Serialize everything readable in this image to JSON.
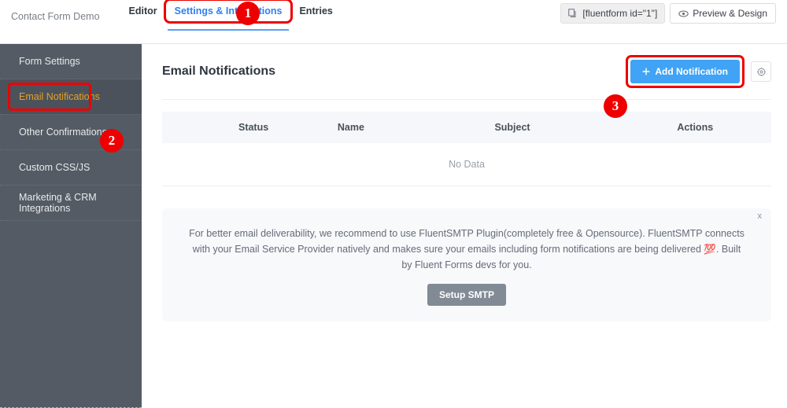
{
  "topbar": {
    "form_title": "Contact Form Demo",
    "tabs": [
      {
        "label": "Editor",
        "active": false
      },
      {
        "label": "Settings & Integrations",
        "active": true
      },
      {
        "label": "Entries",
        "active": false
      }
    ],
    "shortcode": "[fluentform id=\"1\"]",
    "shortcode_icon": "copy-icon",
    "preview_label": "Preview & Design",
    "preview_icon": "eye-icon"
  },
  "badges": {
    "one": "1",
    "two": "2",
    "three": "3",
    "color": "#ee0000"
  },
  "sidebar": {
    "items": [
      {
        "label": "Form Settings"
      },
      {
        "label": "Email Notifications"
      },
      {
        "label": "Other Confirmations"
      },
      {
        "label": "Custom CSS/JS"
      },
      {
        "label": "Marketing & CRM Integrations"
      }
    ],
    "active_index": 1,
    "active_color": "#e8a020",
    "background": "#545b64"
  },
  "main": {
    "title": "Email Notifications",
    "add_button_label": "Add Notification",
    "add_button_icon": "plus-icon",
    "add_button_color": "#41a3f5",
    "settings_icon": "gear-icon",
    "table": {
      "columns": [
        "",
        "Status",
        "Name",
        "Subject",
        "Actions"
      ],
      "rows": [],
      "empty_text": "No Data"
    },
    "notice": {
      "close_label": "x",
      "text": "For better email deliverability, we recommend to use FluentSMTP Plugin(completely free & Opensource). FluentSMTP connects with your Email Service Provider natively and makes sure your emails including form notifications are being delivered 💯. Built by Fluent Forms devs for you.",
      "button_label": "Setup SMTP"
    }
  }
}
